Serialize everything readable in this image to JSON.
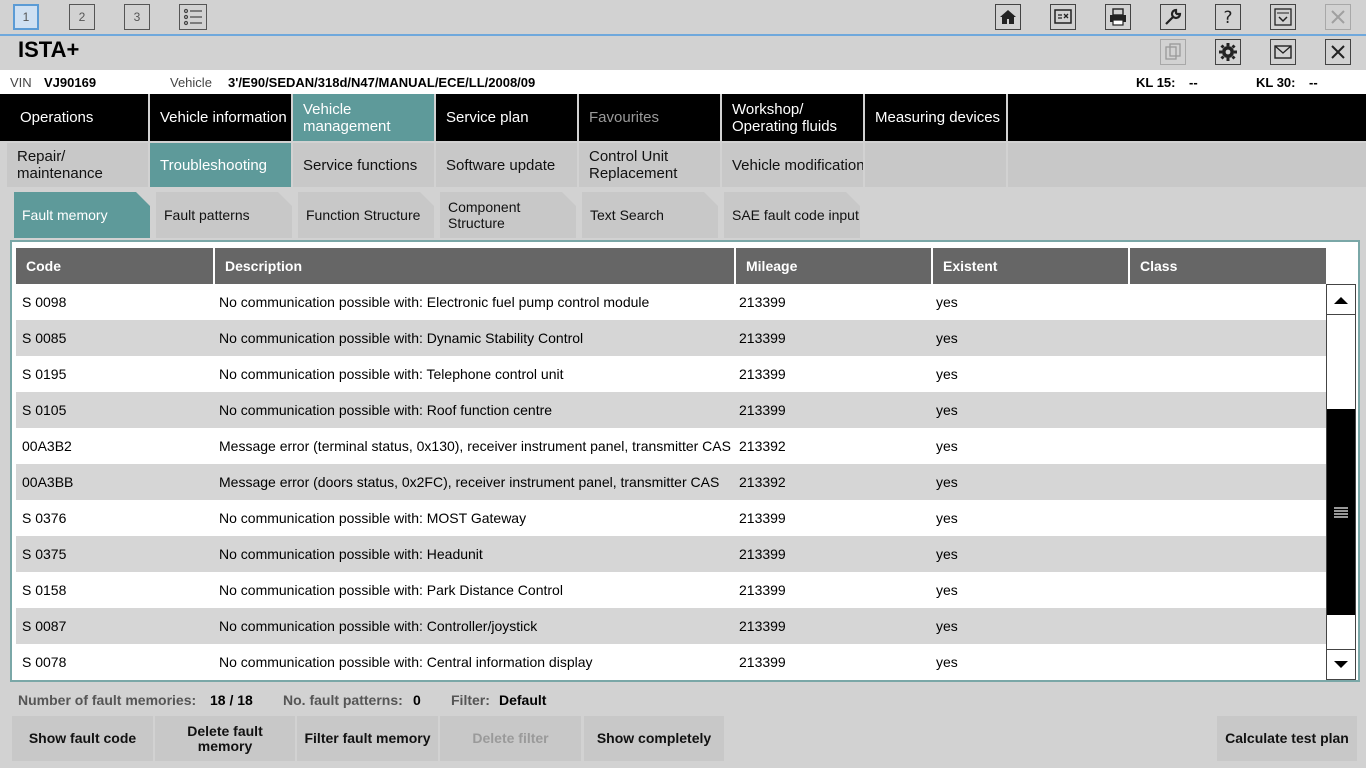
{
  "topbar": {
    "tabs": [
      "1",
      "2",
      "3"
    ],
    "icons": [
      "home-icon",
      "swap-icon",
      "printer-icon",
      "wrench-icon",
      "help-icon",
      "dropdown-panel-icon",
      "close-icon"
    ]
  },
  "titlebar": {
    "title": "ISTA+",
    "icons": [
      "document-copy-icon",
      "gear-icon",
      "mail-icon",
      "close-icon"
    ]
  },
  "vehicle_bar": {
    "vin_label": "VIN",
    "vin_value": "VJ90169",
    "vehicle_label": "Vehicle",
    "vehicle_value": "3'/E90/SEDAN/318d/N47/MANUAL/ECE/LL/2008/09",
    "kl15_label": "KL 15:",
    "kl15_value": "--",
    "kl30_label": "KL 30:",
    "kl30_value": "--"
  },
  "main_nav": [
    "Operations",
    "Vehicle information",
    "Vehicle management",
    "Service plan",
    "Favourites",
    "Workshop/ Operating fluids",
    "Measuring devices"
  ],
  "second_nav": [
    "Repair/ maintenance",
    "Troubleshooting",
    "Service functions",
    "Software update",
    "Control Unit Replacement",
    "Vehicle modification"
  ],
  "sub_tabs": [
    "Fault memory",
    "Fault patterns",
    "Function Structure",
    "Component Structure",
    "Text Search",
    "SAE fault code input"
  ],
  "table": {
    "columns": [
      "Code",
      "Description",
      "Mileage",
      "Existent",
      "Class"
    ],
    "rows": [
      {
        "code": "S 0098",
        "description": "No communication possible with: Electronic fuel pump control module",
        "mileage": "213399",
        "existent": "yes",
        "class": ""
      },
      {
        "code": "S 0085",
        "description": "No communication possible with: Dynamic Stability Control",
        "mileage": "213399",
        "existent": "yes",
        "class": ""
      },
      {
        "code": "S 0195",
        "description": "No communication possible with: Telephone control unit",
        "mileage": "213399",
        "existent": "yes",
        "class": ""
      },
      {
        "code": "S 0105",
        "description": "No communication possible with: Roof function centre",
        "mileage": "213399",
        "existent": "yes",
        "class": ""
      },
      {
        "code": "00A3B2",
        "description": "Message error (terminal status, 0x130), receiver instrument panel, transmitter CAS",
        "mileage": "213392",
        "existent": "yes",
        "class": ""
      },
      {
        "code": "00A3BB",
        "description": "Message error (doors status, 0x2FC), receiver instrument panel, transmitter CAS",
        "mileage": "213392",
        "existent": "yes",
        "class": ""
      },
      {
        "code": "S 0376",
        "description": "No communication possible with: MOST Gateway",
        "mileage": "213399",
        "existent": "yes",
        "class": ""
      },
      {
        "code": "S 0375",
        "description": "No communication possible with: Headunit",
        "mileage": "213399",
        "existent": "yes",
        "class": ""
      },
      {
        "code": "S 0158",
        "description": "No communication possible with: Park Distance Control",
        "mileage": "213399",
        "existent": "yes",
        "class": ""
      },
      {
        "code": "S 0087",
        "description": "No communication possible with: Controller/joystick",
        "mileage": "213399",
        "existent": "yes",
        "class": ""
      },
      {
        "code": "S 0078",
        "description": "No communication possible with: Central information display",
        "mileage": "213399",
        "existent": "yes",
        "class": ""
      }
    ]
  },
  "status": {
    "fault_memories_label": "Number of fault memories:",
    "fault_memories_value": "18 / 18",
    "fault_patterns_label": "No. fault patterns:",
    "fault_patterns_value": "0",
    "filter_label": "Filter:",
    "filter_value": "Default"
  },
  "buttons": {
    "show_fault_code": "Show fault code",
    "delete_fault_memory": "Delete fault memory",
    "filter_fault_memory": "Filter fault memory",
    "delete_filter": "Delete filter",
    "show_completely": "Show completely",
    "calculate_test_plan": "Calculate test plan"
  },
  "colors": {
    "accent": "#5e9a9a",
    "header": "#666666",
    "nav_bg": "#000000"
  }
}
